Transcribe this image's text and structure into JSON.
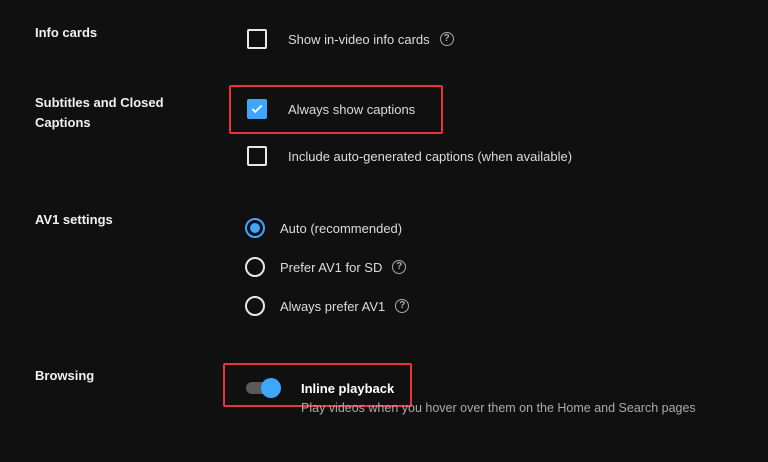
{
  "sections": {
    "info_cards": {
      "label": "Info cards",
      "option_label": "Show in-video info cards",
      "checked": false
    },
    "subtitles": {
      "label": "Subtitles and Closed Captions",
      "always_show_label": "Always show captions",
      "always_show_checked": true,
      "auto_generated_label": "Include auto-generated captions (when available)",
      "auto_generated_checked": false
    },
    "av1": {
      "label": "AV1 settings",
      "options": [
        {
          "label": "Auto (recommended)",
          "selected": true
        },
        {
          "label": "Prefer AV1 for SD",
          "selected": false
        },
        {
          "label": "Always prefer AV1",
          "selected": false
        }
      ]
    },
    "browsing": {
      "label": "Browsing",
      "toggle_label": "Inline playback",
      "toggle_on": true,
      "description": "Play videos when you hover over them on the Home and Search pages"
    }
  },
  "help_glyph": "?",
  "colors": {
    "accent": "#3ea6ff",
    "highlight": "#e8323c",
    "background": "#101010"
  },
  "icons": [
    "help-icon",
    "check-icon"
  ]
}
